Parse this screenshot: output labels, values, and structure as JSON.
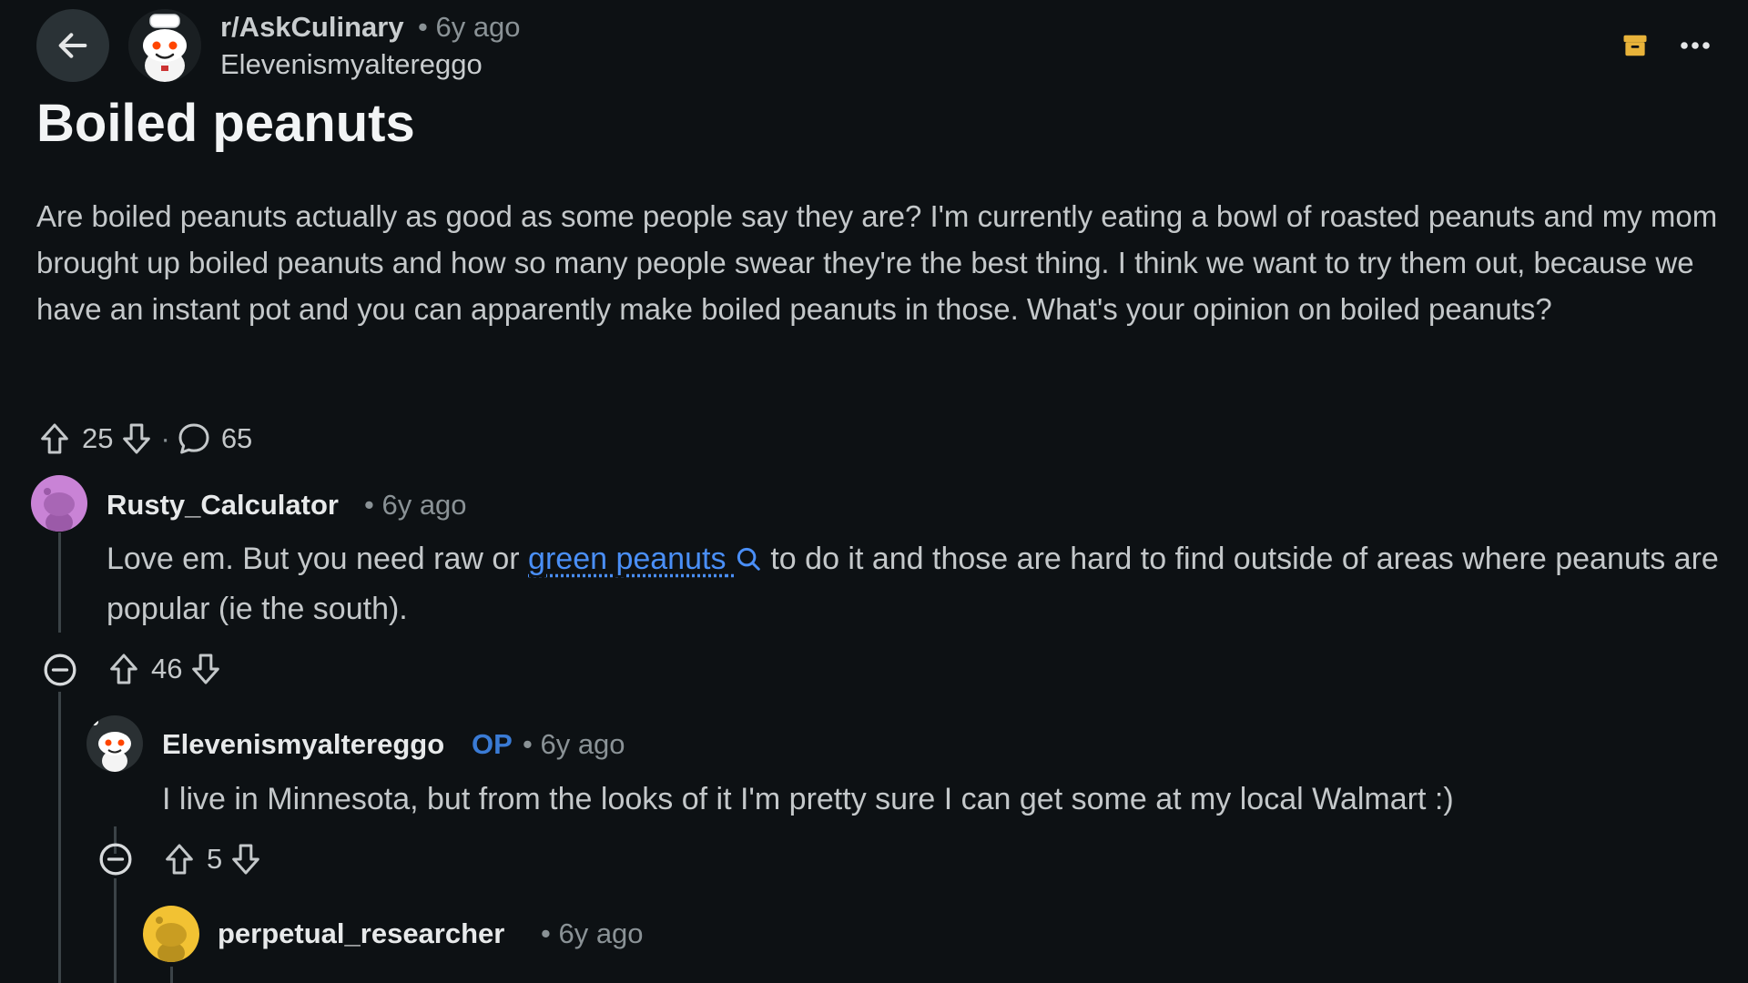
{
  "post": {
    "subreddit": "r/AskCulinary",
    "time": "• 6y ago",
    "author": "Elevenismyaltereggo",
    "title": "Boiled peanuts",
    "body": "Are boiled peanuts actually as good as some people say they are? I'm currently eating a bowl of roasted peanuts and my mom brought up boiled peanuts and how so many people swear they're the best thing. I think we want to try them out, because we have an instant pot and you can apparently make boiled peanuts in those. What's your opinion on boiled peanuts?",
    "votes": "25",
    "separator": "·",
    "comments": "65"
  },
  "comments": [
    {
      "author": "Rusty_Calculator",
      "time": "• 6y ago",
      "body_before": "Love em. But you need raw or ",
      "link": "green peanuts",
      "body_after": " to do it and those are hard to find outside of areas where peanuts are popular (ie the south).",
      "votes": "46",
      "avatar_color": "#c983d6"
    },
    {
      "author": "Elevenismyaltereggo",
      "op": "OP",
      "time": "• 6y ago",
      "body": "I live in Minnesota, but from the looks of it I'm pretty sure I can get some at my local Walmart :)",
      "votes": "5",
      "avatar_color": "#2a3033"
    },
    {
      "author": "perpetual_researcher",
      "time": "• 6y ago",
      "avatar_color": "#f2c233"
    }
  ],
  "colors": {
    "background": "#0d1114",
    "link": "#4a8ff7",
    "op_badge": "#3a7bd5",
    "archive": "#e8b33a"
  },
  "icons": {
    "back": "arrow-left-icon",
    "archive": "archive-icon",
    "more": "more-horizontal-icon",
    "upvote": "upvote-arrow-icon",
    "downvote": "downvote-arrow-icon",
    "comment": "comment-bubble-icon",
    "collapse": "collapse-minus-icon",
    "search": "search-icon"
  }
}
